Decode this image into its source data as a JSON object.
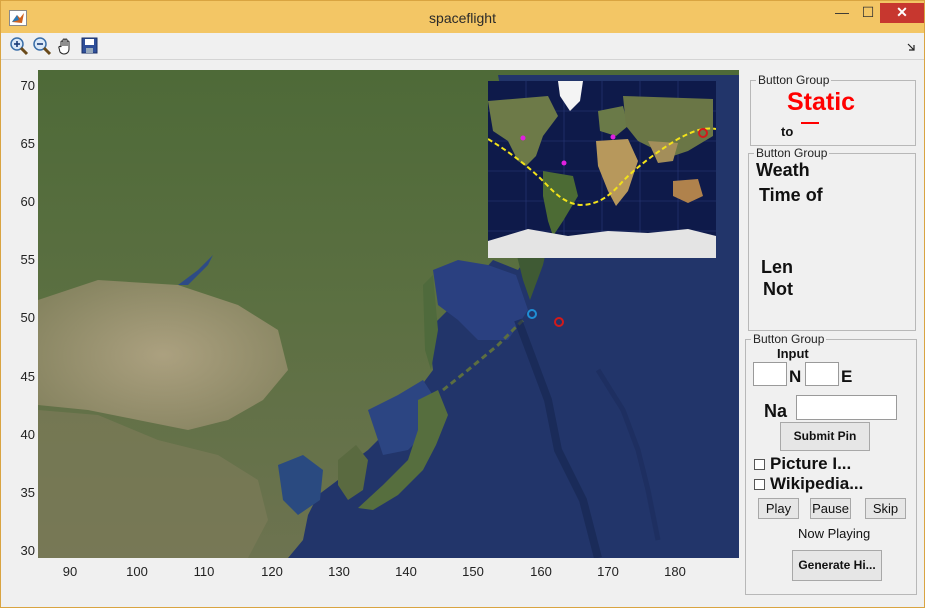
{
  "window": {
    "title": "spaceflight",
    "minimize": "—",
    "maximize": "☐",
    "close": "✕"
  },
  "toolbar": {
    "tools": [
      "zoom-in-icon",
      "zoom-out-icon",
      "pan-hand-icon",
      "save-icon"
    ]
  },
  "axes": {
    "yticks": [
      "70",
      "65",
      "60",
      "55",
      "50",
      "45",
      "40",
      "35",
      "30"
    ],
    "xticks": [
      "90",
      "100",
      "110",
      "120",
      "130",
      "140",
      "150",
      "160",
      "170",
      "180"
    ]
  },
  "panel1": {
    "group_label": "Button Group",
    "status": "Static",
    "to_label": "to"
  },
  "panel2": {
    "group_label": "Button Group",
    "weather": "Weath",
    "time_of": "Time of",
    "len": "Len",
    "not": "Not"
  },
  "panel3": {
    "group_label": "Button Group",
    "input_label": "Input",
    "lat_value": "",
    "n_label": "N",
    "lon_value": "",
    "e_label": "E",
    "name_label": "Na",
    "name_value": "",
    "submit_label": "Submit Pin",
    "picture_label": "Picture I...",
    "wikipedia_label": "Wikipedia...",
    "play_label": "Play",
    "pause_label": "Pause",
    "skip_label": "Skip",
    "now_playing": "Now Playing",
    "generate_label": "Generate Hi..."
  },
  "colors": {
    "status_red": "#ff0000",
    "titlebar": "#f3c665",
    "marker_blue": "#1f8fd6",
    "marker_red": "#d31a1a",
    "track_yellow": "#f2e21a",
    "pin_magenta": "#e020e0"
  }
}
